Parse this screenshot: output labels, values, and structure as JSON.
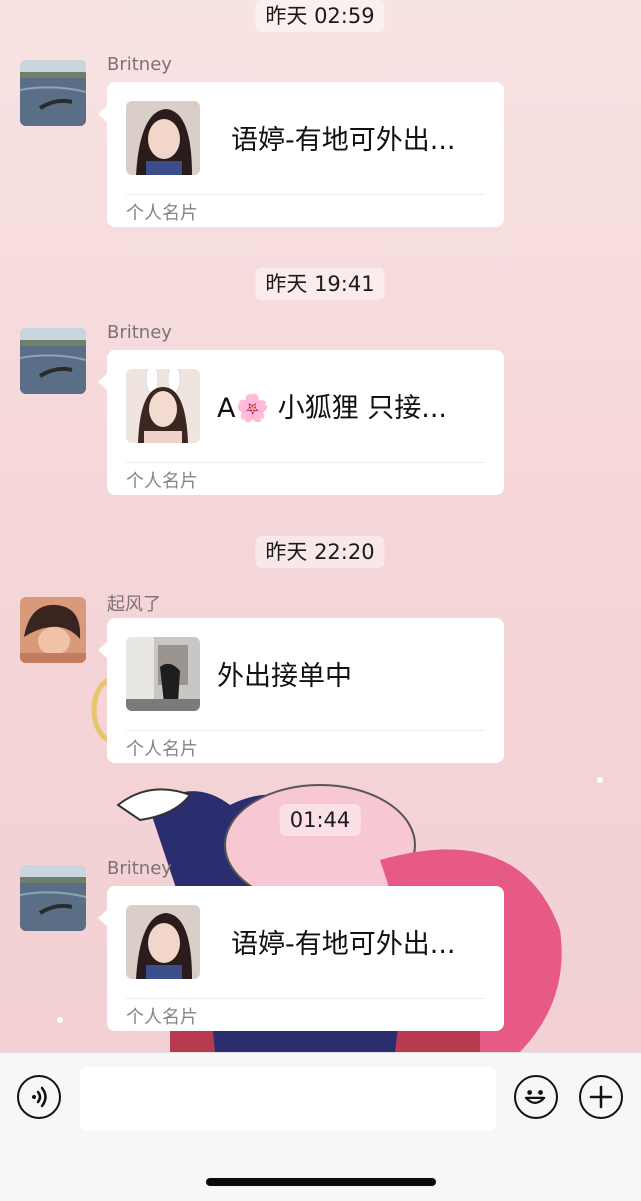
{
  "messages": [
    {
      "timestamp": "昨天 02:59",
      "sender": "Britney",
      "avatar_icon": "lake-photo-avatar",
      "card": {
        "name": "语婷-有地可外出...",
        "type": "个人名片",
        "photo_icon": "girl-portrait-photo"
      }
    },
    {
      "timestamp": "昨天 19:41",
      "sender": "Britney",
      "avatar_icon": "lake-photo-avatar",
      "card": {
        "name": "A🌸 小狐狸 只接...",
        "type": "个人名片",
        "photo_icon": "girl-bunny-ears-photo"
      }
    },
    {
      "timestamp": "昨天 22:20",
      "sender": "起风了",
      "avatar_icon": "anime-boy-avatar",
      "card": {
        "name": "外出接单中",
        "type": "个人名片",
        "photo_icon": "room-photo"
      }
    },
    {
      "timestamp": "01:44",
      "sender": "Britney",
      "avatar_icon": "lake-photo-avatar",
      "card": {
        "name": "语婷-有地可外出...",
        "type": "个人名片",
        "photo_icon": "girl-portrait-photo"
      }
    }
  ],
  "input_bar": {
    "voice_icon": "voice-icon",
    "emoji_icon": "emoji-icon",
    "plus_icon": "plus-icon",
    "input_value": ""
  },
  "colors": {
    "wallpaper": "#f6dcdc",
    "card_bg": "#ffffff",
    "input_bar_bg": "#f7f7f7"
  }
}
